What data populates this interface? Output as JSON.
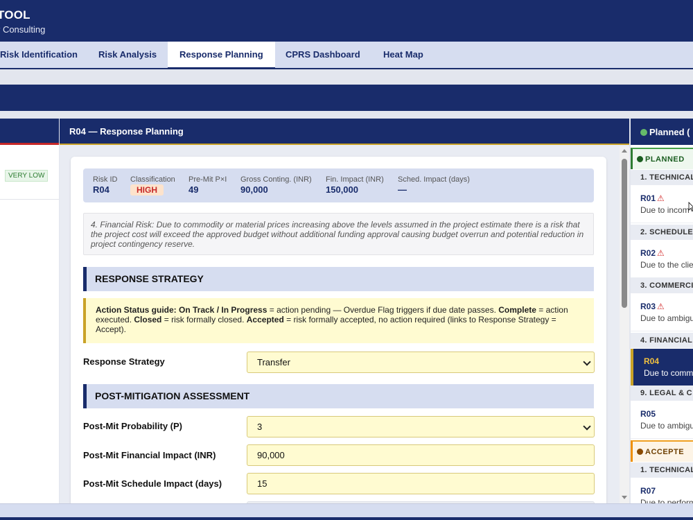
{
  "header": {
    "title": "TOOL",
    "subtitle": "r Consulting"
  },
  "tabs": [
    {
      "label": "Risk Identification"
    },
    {
      "label": "Risk Analysis"
    },
    {
      "label": "Response Planning",
      "active": true
    },
    {
      "label": "CPRS Dashboard"
    },
    {
      "label": "Heat Map"
    }
  ],
  "left": {
    "rating": "VERY LOW"
  },
  "center": {
    "title_id": "R04",
    "title_sep": "—",
    "title_text": "Response Planning",
    "summary": {
      "risk_id_label": "Risk ID",
      "risk_id": "R04",
      "classification_label": "Classification",
      "classification": "HIGH",
      "premit_label": "Pre-Mit P×I",
      "premit": "49",
      "gross_label": "Gross Conting. (INR)",
      "gross": "90,000",
      "fin_label": "Fin. Impact (INR)",
      "fin": "150,000",
      "sched_label": "Sched. Impact (days)",
      "sched": "—"
    },
    "description": "4. Financial Risk: Due to commodity or material prices increasing above the levels assumed in the project estimate there is a risk that the project cost will exceed the approved budget without additional funding approval causing budget overrun and potential reduction in project contingency reserve.",
    "section_response": "RESPONSE STRATEGY",
    "guide": {
      "g1": "Action Status guide: On Track / In Progress",
      "g2": " = action pending — Overdue Flag triggers if due date passes. ",
      "g3": "Complete",
      "g4": " = action executed. ",
      "g5": "Closed",
      "g6": " = risk formally closed. ",
      "g7": "Accepted",
      "g8": " = risk formally accepted, no action required (links to Response Strategy = Accept)."
    },
    "response_label": "Response Strategy",
    "response_value": "Transfer",
    "section_postmit": "POST-MITIGATION ASSESSMENT",
    "prob_label": "Post-Mit Probability (P)",
    "prob_value": "3",
    "fin_label": "Post-Mit Financial Impact (INR)",
    "fin_value": "90,000",
    "sched_label": "Post-Mit Schedule Impact (days)",
    "sched_value": "15"
  },
  "right": {
    "head": "Planned (",
    "group_planned": "PLANNED",
    "group_accepted": "ACCEPTE",
    "cat1": "1. TECHNICAL",
    "cat2": "2. SCHEDULE",
    "cat3": "3. COMMERCI",
    "cat4": "4. FINANCIAL",
    "cat9": "9. LEGAL & C",
    "cat1b": "1. TECHNICAL",
    "items": [
      {
        "id": "R01",
        "text": "Due to incom"
      },
      {
        "id": "R02",
        "text": "Due to the clie"
      },
      {
        "id": "R03",
        "text": "Due to ambigu"
      },
      {
        "id": "R04",
        "text": "Due to comm"
      },
      {
        "id": "R05",
        "text": "Due to ambigu"
      },
      {
        "id": "R07",
        "text": "Due to perform"
      }
    ]
  },
  "colors": {
    "navy": "#192c6b",
    "accent": "#c9a227",
    "high": "#c62828",
    "planned": "#43a047",
    "accepted": "#ef8f00"
  }
}
